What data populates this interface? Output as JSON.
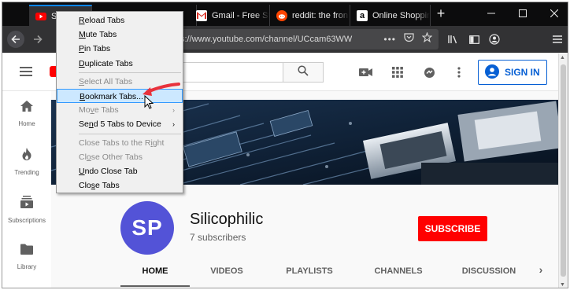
{
  "browser": {
    "tabs": [
      {
        "label": "Si",
        "favicon": "youtube-favicon",
        "active": true
      },
      {
        "label": "",
        "favicon": "",
        "active": false
      },
      {
        "label": "Gmail - Free St",
        "favicon": "gmail-favicon",
        "active": false
      },
      {
        "label": "reddit: the fron",
        "favicon": "reddit-favicon",
        "active": false
      },
      {
        "label": "Online Shoppin",
        "favicon": "amazon-favicon",
        "active": false
      }
    ],
    "new_tab_icon": "plus-icon",
    "window_controls": [
      "minimize-icon",
      "maximize-icon",
      "close-icon"
    ],
    "url_fragment": "s://www.youtube.com/channel/UCcam63WW",
    "url_icons": [
      "more-icon",
      "pocket-icon",
      "star-icon"
    ],
    "toolbar_icons": [
      "library-icon",
      "sidebar-icon",
      "account-icon",
      "menu-icon"
    ]
  },
  "context_menu": {
    "items": [
      {
        "label": "Reload Tabs",
        "mnemonic": "R",
        "disabled": false
      },
      {
        "label": "Mute Tabs",
        "mnemonic": "M",
        "disabled": false
      },
      {
        "label": "Pin Tabs",
        "mnemonic": "P",
        "disabled": false
      },
      {
        "label": "Duplicate Tabs",
        "mnemonic": "D",
        "disabled": false
      },
      {
        "separator": true
      },
      {
        "label": "Select All Tabs",
        "mnemonic": "S",
        "disabled": true
      },
      {
        "label": "Bookmark Tabs...",
        "mnemonic": "B",
        "disabled": false,
        "highlighted": true
      },
      {
        "label": "Move Tabs",
        "mnemonic": "v",
        "disabled": true,
        "submenu": true
      },
      {
        "label": "Send 5 Tabs to Device",
        "mnemonic": "n",
        "disabled": false,
        "submenu": true
      },
      {
        "separator": true
      },
      {
        "label": "Close Tabs to the Right",
        "mnemonic": "i",
        "disabled": true
      },
      {
        "label": "Close Other Tabs",
        "mnemonic": "o",
        "disabled": true
      },
      {
        "label": "Undo Close Tab",
        "mnemonic": "U",
        "disabled": false
      },
      {
        "label": "Close Tabs",
        "mnemonic": "s",
        "disabled": false
      }
    ]
  },
  "youtube": {
    "signin_label": "SIGN IN",
    "sidebar": [
      {
        "label": "Home",
        "icon": "home-icon"
      },
      {
        "label": "Trending",
        "icon": "trending-icon"
      },
      {
        "label": "Subscriptions",
        "icon": "subscriptions-icon"
      },
      {
        "label": "Library",
        "icon": "library-icon"
      }
    ],
    "channel": {
      "avatar_text": "SP",
      "name": "Silicophilic",
      "subscribers": "7 subscribers",
      "subscribe_label": "SUBSCRIBE"
    },
    "tabs": [
      "HOME",
      "VIDEOS",
      "PLAYLISTS",
      "CHANNELS",
      "DISCUSSION"
    ],
    "active_tab": "HOME"
  },
  "colors": {
    "accent_blue": "#065fd4",
    "youtube_red": "#ff0000",
    "avatar_purple": "#5353d7",
    "menu_highlight": "#cce8ff",
    "annotation_arrow": "#e8323c"
  }
}
